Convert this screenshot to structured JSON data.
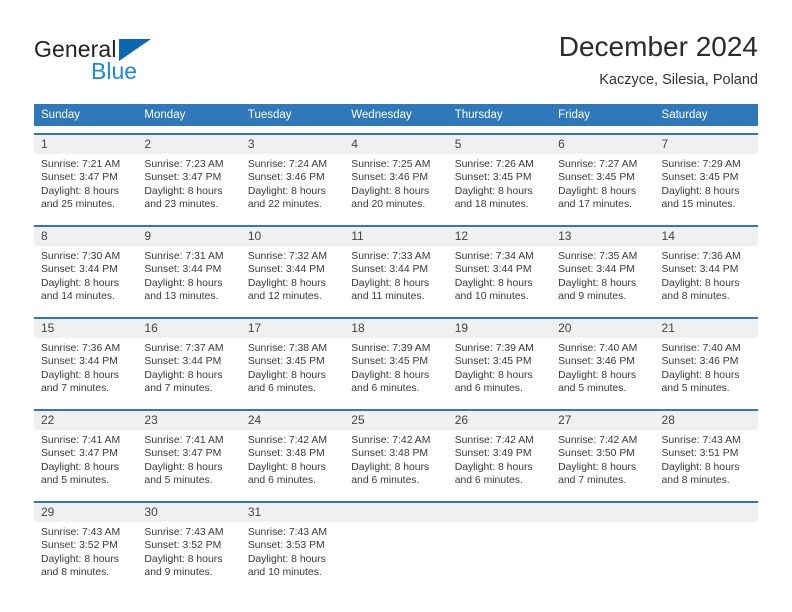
{
  "brand": {
    "name_part1": "General",
    "name_part2": "Blue",
    "color_dark": "#231f20",
    "color_blue": "#1b8ada",
    "triangle_color": "#0c67b2"
  },
  "header": {
    "title": "December 2024",
    "subtitle": "Kaczyce, Silesia, Poland"
  },
  "theme": {
    "header_row_bg": "#2f78b9",
    "day_band_bg": "#f0f0f0",
    "separator": "#2f78b9"
  },
  "weekdays": [
    "Sunday",
    "Monday",
    "Tuesday",
    "Wednesday",
    "Thursday",
    "Friday",
    "Saturday"
  ],
  "weeks": [
    [
      {
        "day": "1",
        "sunrise": "Sunrise: 7:21 AM",
        "sunset": "Sunset: 3:47 PM",
        "daylight1": "Daylight: 8 hours",
        "daylight2": "and 25 minutes."
      },
      {
        "day": "2",
        "sunrise": "Sunrise: 7:23 AM",
        "sunset": "Sunset: 3:47 PM",
        "daylight1": "Daylight: 8 hours",
        "daylight2": "and 23 minutes."
      },
      {
        "day": "3",
        "sunrise": "Sunrise: 7:24 AM",
        "sunset": "Sunset: 3:46 PM",
        "daylight1": "Daylight: 8 hours",
        "daylight2": "and 22 minutes."
      },
      {
        "day": "4",
        "sunrise": "Sunrise: 7:25 AM",
        "sunset": "Sunset: 3:46 PM",
        "daylight1": "Daylight: 8 hours",
        "daylight2": "and 20 minutes."
      },
      {
        "day": "5",
        "sunrise": "Sunrise: 7:26 AM",
        "sunset": "Sunset: 3:45 PM",
        "daylight1": "Daylight: 8 hours",
        "daylight2": "and 18 minutes."
      },
      {
        "day": "6",
        "sunrise": "Sunrise: 7:27 AM",
        "sunset": "Sunset: 3:45 PM",
        "daylight1": "Daylight: 8 hours",
        "daylight2": "and 17 minutes."
      },
      {
        "day": "7",
        "sunrise": "Sunrise: 7:29 AM",
        "sunset": "Sunset: 3:45 PM",
        "daylight1": "Daylight: 8 hours",
        "daylight2": "and 15 minutes."
      }
    ],
    [
      {
        "day": "8",
        "sunrise": "Sunrise: 7:30 AM",
        "sunset": "Sunset: 3:44 PM",
        "daylight1": "Daylight: 8 hours",
        "daylight2": "and 14 minutes."
      },
      {
        "day": "9",
        "sunrise": "Sunrise: 7:31 AM",
        "sunset": "Sunset: 3:44 PM",
        "daylight1": "Daylight: 8 hours",
        "daylight2": "and 13 minutes."
      },
      {
        "day": "10",
        "sunrise": "Sunrise: 7:32 AM",
        "sunset": "Sunset: 3:44 PM",
        "daylight1": "Daylight: 8 hours",
        "daylight2": "and 12 minutes."
      },
      {
        "day": "11",
        "sunrise": "Sunrise: 7:33 AM",
        "sunset": "Sunset: 3:44 PM",
        "daylight1": "Daylight: 8 hours",
        "daylight2": "and 11 minutes."
      },
      {
        "day": "12",
        "sunrise": "Sunrise: 7:34 AM",
        "sunset": "Sunset: 3:44 PM",
        "daylight1": "Daylight: 8 hours",
        "daylight2": "and 10 minutes."
      },
      {
        "day": "13",
        "sunrise": "Sunrise: 7:35 AM",
        "sunset": "Sunset: 3:44 PM",
        "daylight1": "Daylight: 8 hours",
        "daylight2": "and 9 minutes."
      },
      {
        "day": "14",
        "sunrise": "Sunrise: 7:36 AM",
        "sunset": "Sunset: 3:44 PM",
        "daylight1": "Daylight: 8 hours",
        "daylight2": "and 8 minutes."
      }
    ],
    [
      {
        "day": "15",
        "sunrise": "Sunrise: 7:36 AM",
        "sunset": "Sunset: 3:44 PM",
        "daylight1": "Daylight: 8 hours",
        "daylight2": "and 7 minutes."
      },
      {
        "day": "16",
        "sunrise": "Sunrise: 7:37 AM",
        "sunset": "Sunset: 3:44 PM",
        "daylight1": "Daylight: 8 hours",
        "daylight2": "and 7 minutes."
      },
      {
        "day": "17",
        "sunrise": "Sunrise: 7:38 AM",
        "sunset": "Sunset: 3:45 PM",
        "daylight1": "Daylight: 8 hours",
        "daylight2": "and 6 minutes."
      },
      {
        "day": "18",
        "sunrise": "Sunrise: 7:39 AM",
        "sunset": "Sunset: 3:45 PM",
        "daylight1": "Daylight: 8 hours",
        "daylight2": "and 6 minutes."
      },
      {
        "day": "19",
        "sunrise": "Sunrise: 7:39 AM",
        "sunset": "Sunset: 3:45 PM",
        "daylight1": "Daylight: 8 hours",
        "daylight2": "and 6 minutes."
      },
      {
        "day": "20",
        "sunrise": "Sunrise: 7:40 AM",
        "sunset": "Sunset: 3:46 PM",
        "daylight1": "Daylight: 8 hours",
        "daylight2": "and 5 minutes."
      },
      {
        "day": "21",
        "sunrise": "Sunrise: 7:40 AM",
        "sunset": "Sunset: 3:46 PM",
        "daylight1": "Daylight: 8 hours",
        "daylight2": "and 5 minutes."
      }
    ],
    [
      {
        "day": "22",
        "sunrise": "Sunrise: 7:41 AM",
        "sunset": "Sunset: 3:47 PM",
        "daylight1": "Daylight: 8 hours",
        "daylight2": "and 5 minutes."
      },
      {
        "day": "23",
        "sunrise": "Sunrise: 7:41 AM",
        "sunset": "Sunset: 3:47 PM",
        "daylight1": "Daylight: 8 hours",
        "daylight2": "and 5 minutes."
      },
      {
        "day": "24",
        "sunrise": "Sunrise: 7:42 AM",
        "sunset": "Sunset: 3:48 PM",
        "daylight1": "Daylight: 8 hours",
        "daylight2": "and 6 minutes."
      },
      {
        "day": "25",
        "sunrise": "Sunrise: 7:42 AM",
        "sunset": "Sunset: 3:48 PM",
        "daylight1": "Daylight: 8 hours",
        "daylight2": "and 6 minutes."
      },
      {
        "day": "26",
        "sunrise": "Sunrise: 7:42 AM",
        "sunset": "Sunset: 3:49 PM",
        "daylight1": "Daylight: 8 hours",
        "daylight2": "and 6 minutes."
      },
      {
        "day": "27",
        "sunrise": "Sunrise: 7:42 AM",
        "sunset": "Sunset: 3:50 PM",
        "daylight1": "Daylight: 8 hours",
        "daylight2": "and 7 minutes."
      },
      {
        "day": "28",
        "sunrise": "Sunrise: 7:43 AM",
        "sunset": "Sunset: 3:51 PM",
        "daylight1": "Daylight: 8 hours",
        "daylight2": "and 8 minutes."
      }
    ],
    [
      {
        "day": "29",
        "sunrise": "Sunrise: 7:43 AM",
        "sunset": "Sunset: 3:52 PM",
        "daylight1": "Daylight: 8 hours",
        "daylight2": "and 8 minutes."
      },
      {
        "day": "30",
        "sunrise": "Sunrise: 7:43 AM",
        "sunset": "Sunset: 3:52 PM",
        "daylight1": "Daylight: 8 hours",
        "daylight2": "and 9 minutes."
      },
      {
        "day": "31",
        "sunrise": "Sunrise: 7:43 AM",
        "sunset": "Sunset: 3:53 PM",
        "daylight1": "Daylight: 8 hours",
        "daylight2": "and 10 minutes."
      },
      {
        "day": "",
        "sunrise": "",
        "sunset": "",
        "daylight1": "",
        "daylight2": ""
      },
      {
        "day": "",
        "sunrise": "",
        "sunset": "",
        "daylight1": "",
        "daylight2": ""
      },
      {
        "day": "",
        "sunrise": "",
        "sunset": "",
        "daylight1": "",
        "daylight2": ""
      },
      {
        "day": "",
        "sunrise": "",
        "sunset": "",
        "daylight1": "",
        "daylight2": ""
      }
    ]
  ]
}
